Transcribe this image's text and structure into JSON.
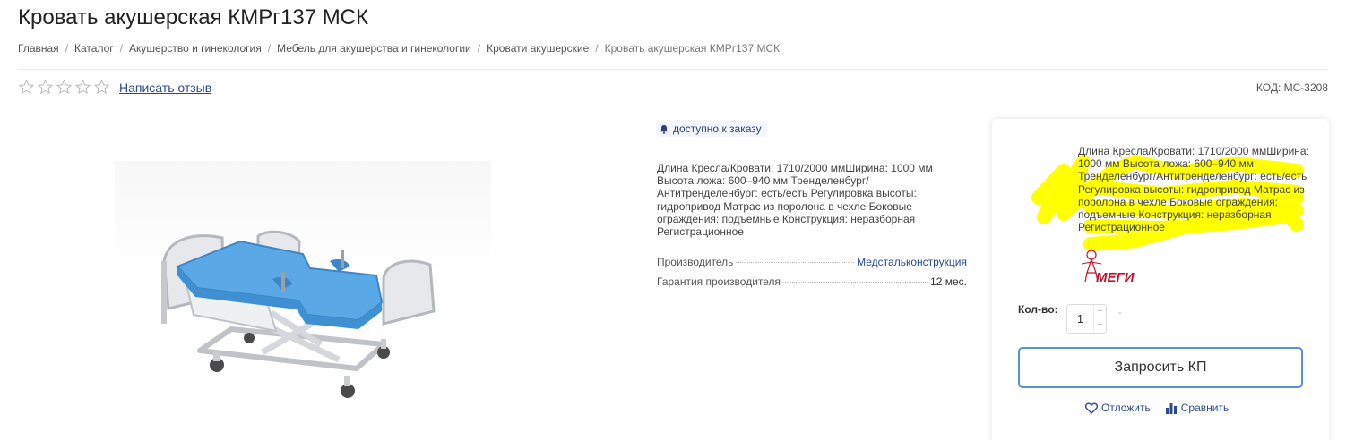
{
  "page": {
    "title": "Кровать акушерская КМРг137 МСК"
  },
  "breadcrumb": [
    "Главная",
    "Каталог",
    "Акушерство и гинекология",
    "Мебель для акушерства и гинекологии",
    "Кровати акушерские",
    "Кровать акушерская КМРг137 МСК"
  ],
  "rating": {
    "stars_filled": 0,
    "stars_total": 5,
    "review_link": "Написать отзыв"
  },
  "sku": "КОД: МС-3208",
  "product": {
    "availability": "доступно к заказу",
    "short_description": "Длина Кресла/Кровати: 1710/2000 ммШирина: 1000 мм Высота ложа: 600–940 мм Тренделенбург/ Антитренделенбург: есть/есть Регулировка высоты: гидропривод Матрас из поролона в чехле Боковые ограждения: подъемные Конструкция: неразборная Регистрационное",
    "properties": [
      {
        "key": "Производитель",
        "value": "Медстальконструкция"
      },
      {
        "key": "Гарантия производителя",
        "value": "12 мес."
      }
    ]
  },
  "buy_panel": {
    "description": "Длина Кресла/Кровати: 1710/2000 ммШирина: 1000 мм Высота ложа: 600–940 мм Тренделенбург/Антитренделенбург: есть/есть Регулировка высоты: гидропривод Матрас из поролона в чехле Боковые ограждения: подъемные Конструкция: неразборная Регистрационное",
    "brand_logo_text": "МЕГИ",
    "highlight_color": "#ffff00",
    "quantity_label": "Кол-во:",
    "quantity_value": "1",
    "quantity_plus": "+",
    "quantity_minus": "−",
    "quantity_dash": "-",
    "request_button": "Запросить КП",
    "defer_label": "Отложить",
    "compare_label": "Сравнить"
  },
  "colors": {
    "link": "#2c4a8e",
    "button_border": "#5a8de8"
  }
}
